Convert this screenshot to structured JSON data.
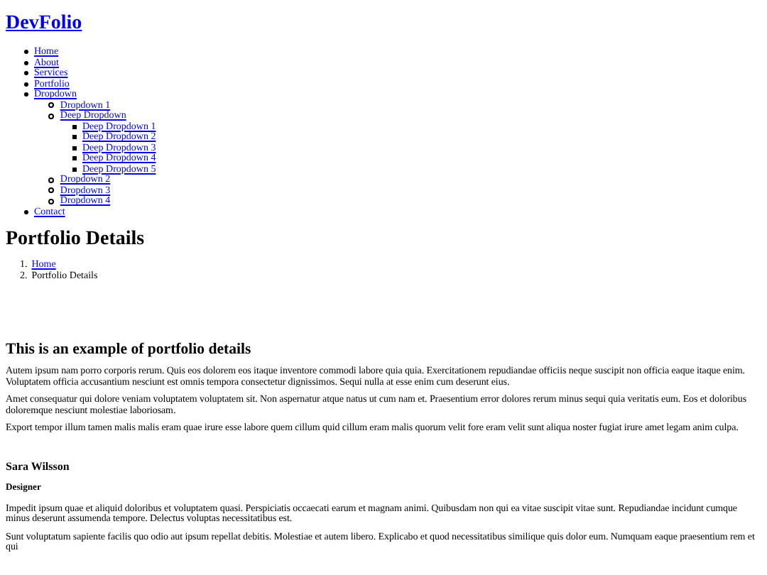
{
  "site_title": "DevFolio",
  "nav": [
    {
      "label": "Home"
    },
    {
      "label": "About"
    },
    {
      "label": "Services"
    },
    {
      "label": "Portfolio"
    },
    {
      "label": "Dropdown",
      "children": [
        {
          "label": "Dropdown 1"
        },
        {
          "label": "Deep Dropdown",
          "children": [
            {
              "label": "Deep Dropdown 1"
            },
            {
              "label": "Deep Dropdown 2"
            },
            {
              "label": "Deep Dropdown 3"
            },
            {
              "label": "Deep Dropdown 4"
            },
            {
              "label": "Deep Dropdown 5"
            }
          ]
        },
        {
          "label": "Dropdown 2"
        },
        {
          "label": "Dropdown 3"
        },
        {
          "label": "Dropdown 4"
        }
      ]
    },
    {
      "label": "Contact"
    }
  ],
  "page_title": "Portfolio Details",
  "breadcrumb": [
    {
      "number": "1.",
      "label": "Home",
      "kind": "link"
    },
    {
      "number": "2.",
      "label": "Portfolio Details",
      "kind": "current"
    }
  ],
  "details_heading": "This is an example of portfolio details",
  "details_paragraphs": [
    "Autem ipsum nam porro corporis rerum. Quis eos dolorem eos itaque inventore commodi labore quia quia. Exercitationem repudiandae officiis neque suscipit non officia eaque itaque enim. Voluptatem officia accusantium nesciunt est omnis tempora consectetur dignissimos. Sequi nulla at esse enim cum deserunt eius.",
    "Amet consequatur qui dolore veniam voluptatem voluptatem sit. Non aspernatur atque natus ut cum nam et. Praesentium error dolores rerum minus sequi quia veritatis eum. Eos et doloribus doloremque nesciunt molestiae laboriosam.",
    "Export tempor illum tamen malis malis eram quae irure esse labore quem cillum quid cillum eram malis quorum velit fore eram velit sunt aliqua noster fugiat irure amet legam anim culpa."
  ],
  "testimonial": {
    "name": "Sara Wilsson",
    "role": "Designer",
    "paragraphs": [
      "Impedit ipsum quae et aliquid doloribus et voluptatem quasi. Perspiciatis occaecati earum et magnam animi. Quibusdam non qui ea vitae suscipit vitae sunt. Repudiandae incidunt cumque minus deserunt assumenda tempore. Delectus voluptas necessitatibus est.",
      "Sunt voluptatum sapiente facilis quo odio aut ipsum repellat debitis. Molestiae et autem libero. Explicabo et quod necessitatibus similique quis dolor eum. Numquam eaque praesentium rem et qui"
    ]
  }
}
